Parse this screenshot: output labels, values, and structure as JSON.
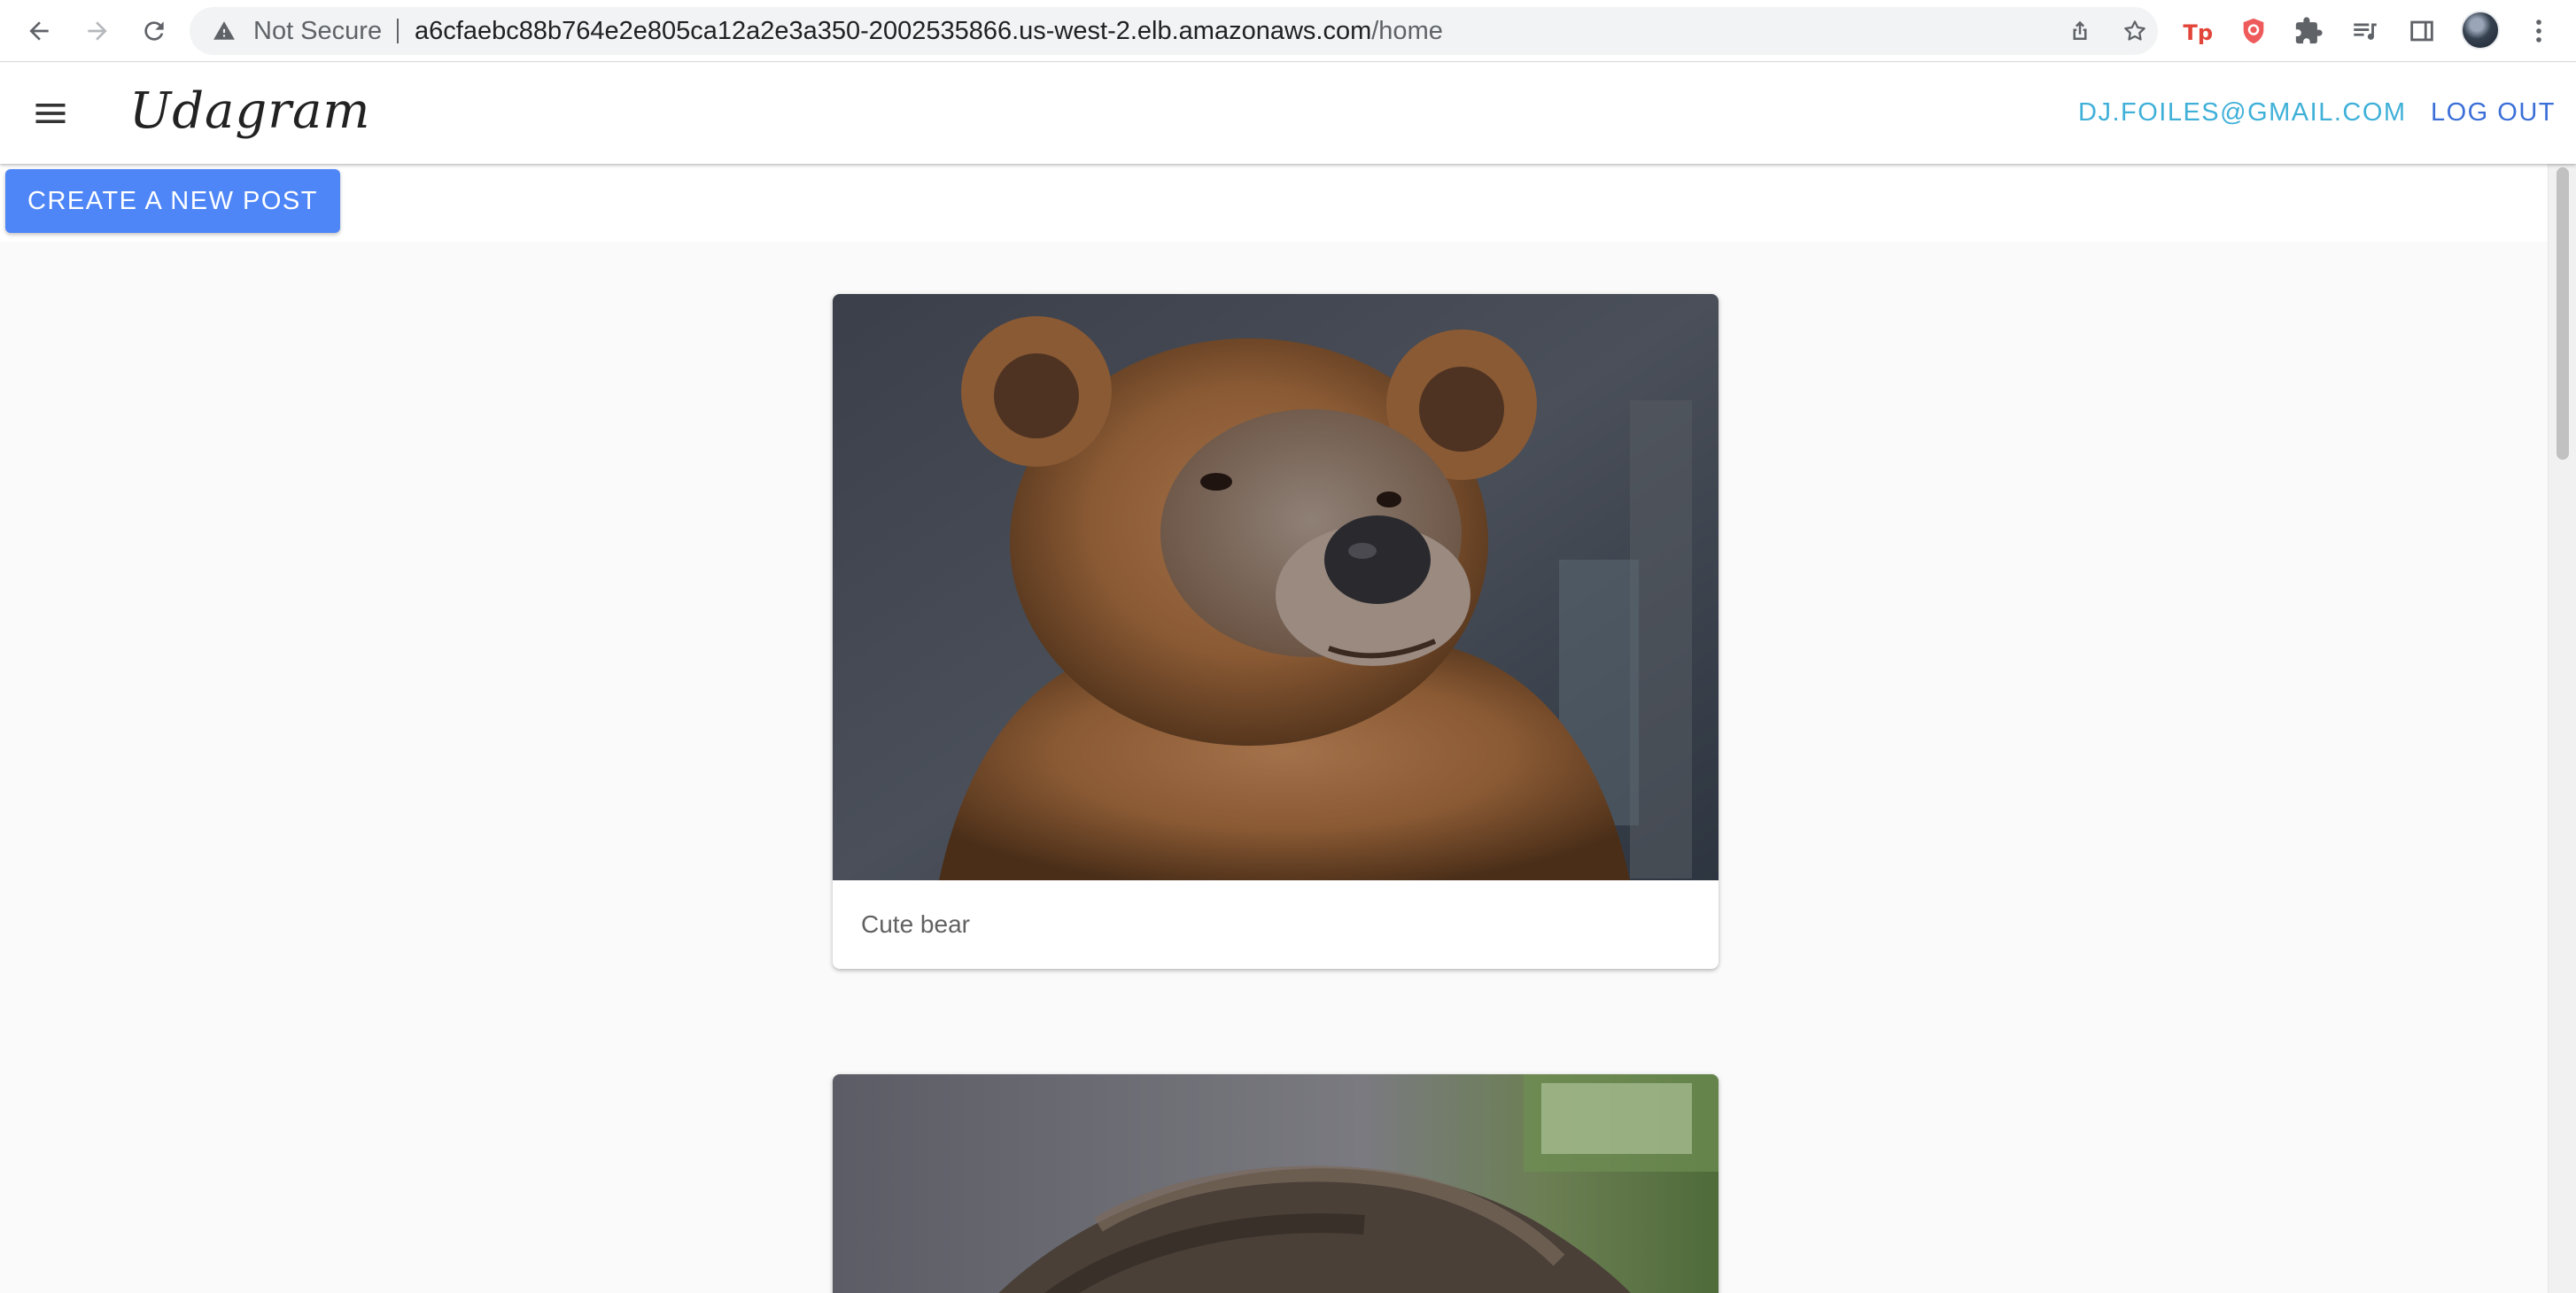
{
  "browser": {
    "security_label": "Not Secure",
    "url_host": "a6cfaebc88b764e2e805ca12a2e3a350-2002535866.us-west-2.elb.amazonaws.com",
    "url_path": "/home",
    "icons": [
      "back-icon",
      "forward-icon",
      "reload-icon",
      "warning-icon",
      "share-icon",
      "bookmark-star-icon",
      "tp-extension-icon",
      "shield-extension-icon",
      "puzzle-extensions-icon",
      "media-queue-icon",
      "side-panel-icon",
      "profile-avatar",
      "more-vert-icon"
    ]
  },
  "app": {
    "brand": "Udagram",
    "user_email": "DJ.FOILES@GMAIL.COM",
    "logout_label": "LOG OUT",
    "create_post_label": "CREATE A NEW POST",
    "colors": {
      "primary_button": "#4f86f7",
      "email_link": "#3fb0d8",
      "logout_link": "#3b6fd8",
      "page_background": "#fafafa"
    }
  },
  "feed": [
    {
      "caption": "Cute bear",
      "image": "brown bear portrait photo"
    },
    {
      "caption": "",
      "image": "furry dog photo (partially visible)"
    }
  ]
}
